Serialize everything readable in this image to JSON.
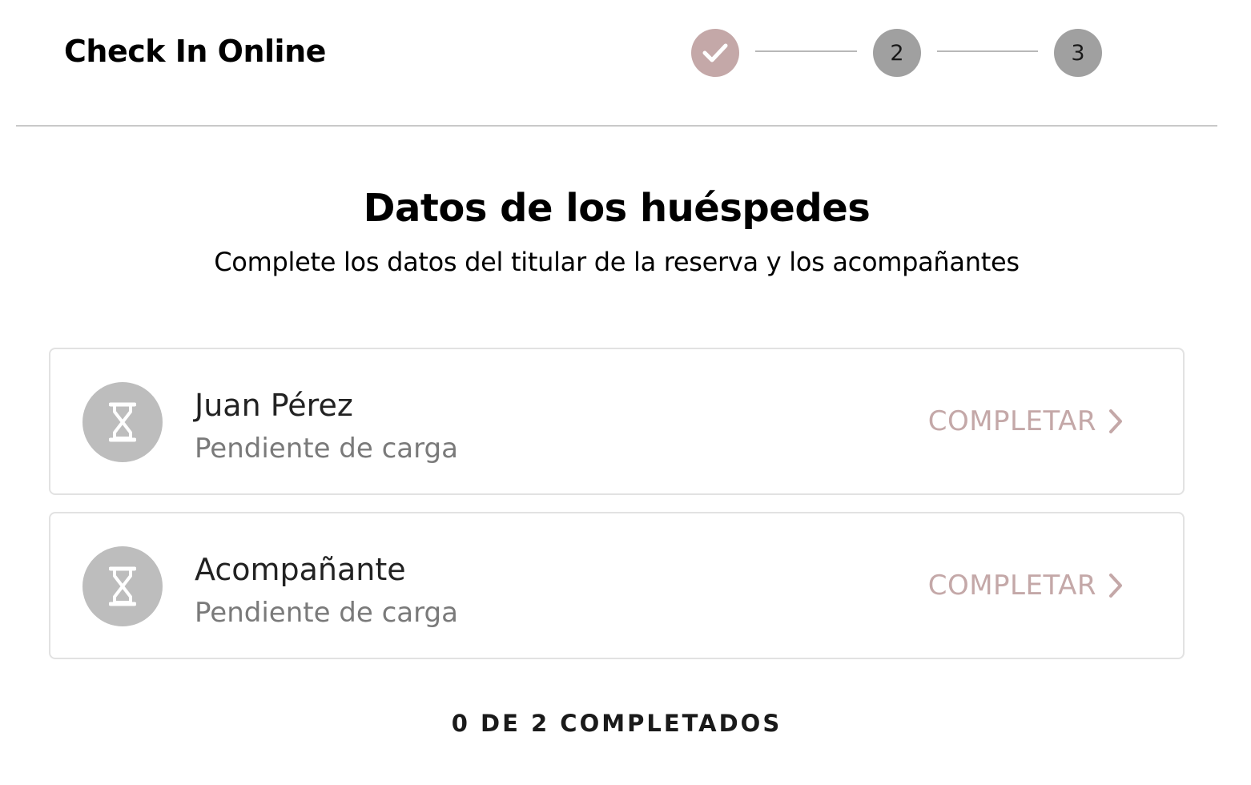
{
  "header": {
    "title": "Check In Online"
  },
  "stepper": {
    "steps": [
      {
        "label": "",
        "state": "completed",
        "icon": "check-icon"
      },
      {
        "label": "2",
        "state": "pending"
      },
      {
        "label": "3",
        "state": "pending"
      }
    ],
    "colors": {
      "completed": "#c4a8a8",
      "pending": "#a0a0a0"
    }
  },
  "main": {
    "title": "Datos de los huéspedes",
    "subtitle": "Complete los datos del titular de la reserva y los acompañantes"
  },
  "guests": [
    {
      "name": "Juan Pérez",
      "status": "Pendiente de carga",
      "icon": "hourglass-icon",
      "action_label": "COMPLETAR",
      "action_icon": "chevron-right-icon"
    },
    {
      "name": "Acompañante",
      "status": "Pendiente de carga",
      "icon": "hourglass-icon",
      "action_label": "COMPLETAR",
      "action_icon": "chevron-right-icon"
    }
  ],
  "progress": {
    "completed": 0,
    "total": 2,
    "text": "0 DE 2 COMPLETADOS"
  },
  "colors": {
    "accent": "#c4a8a8",
    "avatar_bg": "#bdbdbd",
    "divider": "#c9c9c9",
    "card_border": "#e2e2e2",
    "status_text": "#7a7a7a"
  }
}
